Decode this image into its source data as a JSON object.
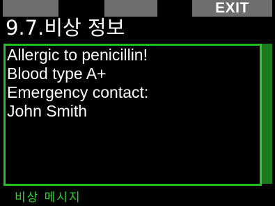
{
  "softkeys": {
    "left_label": "",
    "middle_label": "",
    "right_label": "EXIT"
  },
  "header": {
    "title": "9.7.비상 정보"
  },
  "message": {
    "lines": [
      "Allergic to penicillin!",
      "Blood type A+",
      "Emergency contact:",
      "John Smith"
    ]
  },
  "footer": {
    "label": "비상 메시지"
  },
  "colors": {
    "background": "#000000",
    "text": "#ffffff",
    "accent_green": "#1fbf1f",
    "softkey_gray": "#6e6e6e"
  }
}
